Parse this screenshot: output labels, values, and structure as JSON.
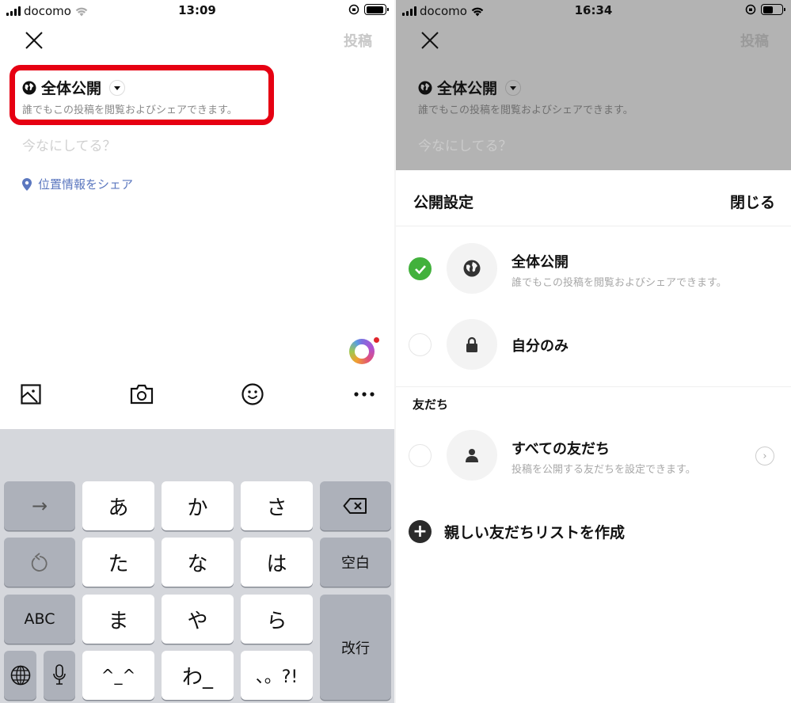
{
  "left": {
    "status": {
      "carrier": "docomo",
      "time": "13:09",
      "battery_level": 0.95
    },
    "header": {
      "close_icon": "close-icon",
      "post_label": "投稿"
    },
    "privacy": {
      "icon": "globe-icon",
      "title": "全体公開",
      "description": "誰でもこの投稿を閲覧およびシェアできます。"
    },
    "composer": {
      "placeholder": "今なにしてる？"
    },
    "location": {
      "icon": "location-pin-icon",
      "label": "位置情報をシェア"
    },
    "toolbar": [
      "image-icon",
      "camera-icon",
      "emoji-icon",
      "more-icon"
    ],
    "keyboard": {
      "rows": [
        [
          "→",
          "あ",
          "か",
          "さ",
          "⌫"
        ],
        [
          "↺",
          "た",
          "な",
          "は",
          "空白"
        ],
        [
          "ABC",
          "ま",
          "や",
          "ら",
          "改行"
        ],
        [
          "🌐",
          "🎤",
          "^_^",
          "わ_",
          "、。?!"
        ]
      ]
    }
  },
  "right": {
    "status": {
      "carrier": "docomo",
      "time": "16:34",
      "battery_level": 0.55
    },
    "header": {
      "post_label": "投稿"
    },
    "privacy": {
      "title": "全体公開",
      "description": "誰でもこの投稿を閲覧およびシェアできます。"
    },
    "composer": {
      "placeholder": "今なにしてる？"
    },
    "sheet": {
      "title": "公開設定",
      "close_label": "閉じる",
      "options": [
        {
          "title": "全体公開",
          "description": "誰でもこの投稿を閲覧およびシェアできます。",
          "icon": "globe-icon",
          "selected": true
        },
        {
          "title": "自分のみ",
          "description": "",
          "icon": "lock-icon",
          "selected": false
        }
      ],
      "friends_section_label": "友だち",
      "friends_option": {
        "title": "すべての友だち",
        "description": "投稿を公開する友だちを設定できます。",
        "icon": "person-icon",
        "selected": false
      },
      "create_list_label": "親しい友だちリストを作成"
    }
  },
  "colors": {
    "highlight_red": "#e60012",
    "check_green": "#42b13c",
    "link_blue": "#5b77bf"
  }
}
